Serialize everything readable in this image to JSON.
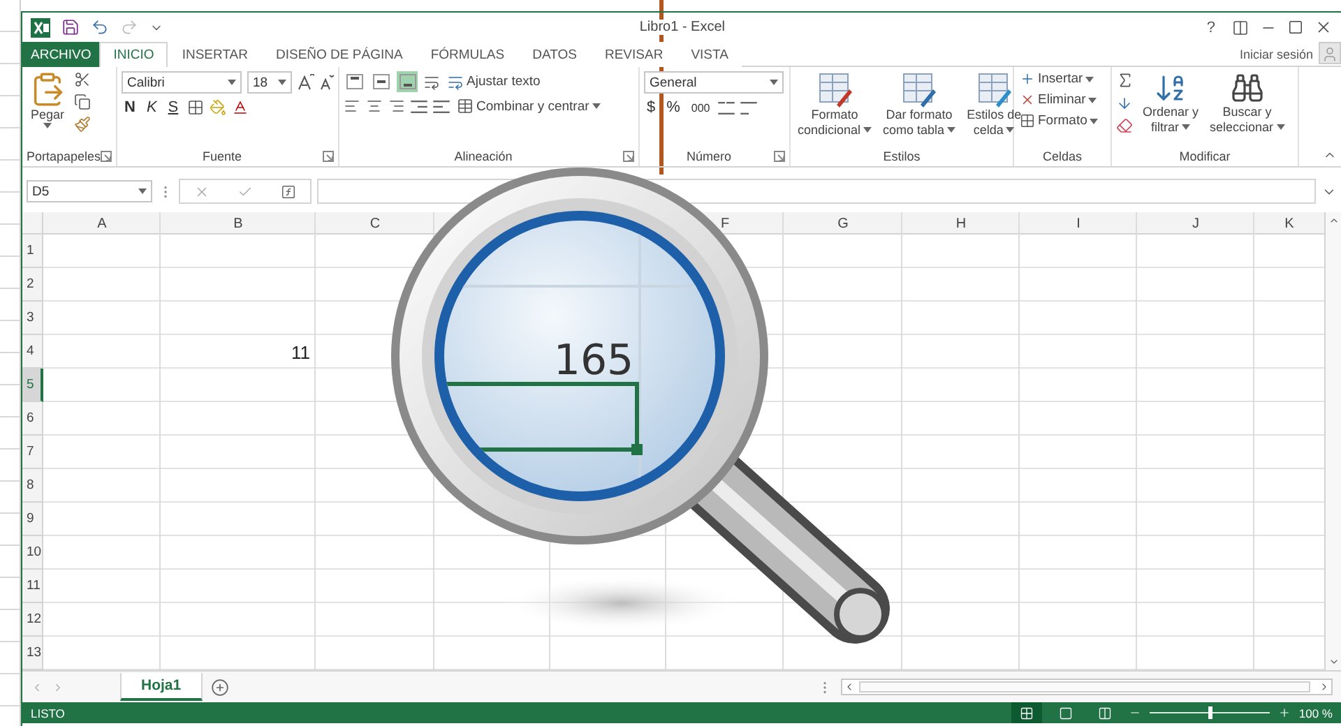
{
  "title_bar": {
    "title": "Libro1 - Excel",
    "help": "?"
  },
  "tabs": [
    {
      "label": "ARCHIVO",
      "kind": "file",
      "selected": false
    },
    {
      "label": "INICIO",
      "kind": "tab",
      "selected": true
    },
    {
      "label": "INSERTAR",
      "kind": "tab",
      "selected": false
    },
    {
      "label": "DISEÑO DE PÁGINA",
      "kind": "tab",
      "selected": false
    },
    {
      "label": "FÓRMULAS",
      "kind": "tab",
      "selected": false
    },
    {
      "label": "DATOS",
      "kind": "tab",
      "selected": false
    },
    {
      "label": "REVISAR",
      "kind": "tab",
      "selected": false
    },
    {
      "label": "VISTA",
      "kind": "tab",
      "selected": false
    }
  ],
  "account": {
    "sign_in": "Iniciar sesión"
  },
  "ribbon": {
    "groups": [
      {
        "kind": "clipboard",
        "label": "Portapapeles",
        "paste": "Pegar"
      },
      {
        "kind": "font",
        "label": "Fuente",
        "font": "Calibri",
        "size": "18",
        "styles": [
          "N",
          "K",
          "S"
        ]
      },
      {
        "kind": "alignment",
        "label": "Alineación",
        "vertical": [
          {
            "selected": false
          },
          {
            "selected": false
          },
          {
            "selected": true
          }
        ],
        "wrap": "Ajustar texto",
        "merge": "Combinar y centrar"
      },
      {
        "kind": "number",
        "label": "Número",
        "format": "General",
        "symbols": [
          "$",
          "%",
          "000"
        ]
      },
      {
        "kind": "styles",
        "label": "Estilos",
        "buttons": [
          {
            "lines": [
              "Formato",
              "condicional"
            ]
          },
          {
            "lines": [
              "Dar formato",
              "como tabla"
            ]
          },
          {
            "lines": [
              "Estilos de",
              "celda"
            ]
          }
        ]
      },
      {
        "kind": "cells",
        "label": "Celdas",
        "buttons": [
          "Insertar",
          "Eliminar",
          "Formato"
        ]
      },
      {
        "kind": "editing",
        "label": "Modificar",
        "buttons": [
          {
            "lines": [
              "Ordenar y",
              "filtrar"
            ]
          },
          {
            "lines": [
              "Buscar y",
              "seleccionar"
            ]
          }
        ]
      }
    ]
  },
  "formula_bar": {
    "name_box": "D5"
  },
  "sheet": {
    "columns": [
      {
        "label": "A"
      },
      {
        "label": "B"
      },
      {
        "label": "C"
      },
      {},
      {},
      {
        "label": "F"
      },
      {
        "label": "G"
      },
      {
        "label": "H"
      },
      {
        "label": "I"
      },
      {
        "label": "J"
      },
      {
        "label": "K"
      }
    ],
    "rows": [
      {
        "label": "1",
        "selected": false
      },
      {
        "label": "2",
        "selected": false
      },
      {
        "label": "3",
        "selected": false
      },
      {
        "label": "4",
        "selected": false,
        "cells": [
          null,
          "11"
        ]
      },
      {
        "label": "5",
        "selected": true
      },
      {
        "label": "6",
        "selected": false
      },
      {
        "label": "7",
        "selected": false
      },
      {
        "label": "8",
        "selected": false
      },
      {
        "label": "9",
        "selected": false
      },
      {
        "label": "10",
        "selected": false
      },
      {
        "label": "11",
        "selected": false
      },
      {
        "label": "12",
        "selected": false
      },
      {
        "label": "13",
        "selected": false
      }
    ]
  },
  "magnifier": {
    "value": "165"
  },
  "sheet_tabs": [
    {
      "label": "Hoja1",
      "selected": true
    }
  ],
  "status_bar": {
    "status": "LISTO",
    "views": [
      {
        "selected": true
      },
      {
        "selected": false
      },
      {
        "selected": false
      }
    ],
    "zoom": {
      "level": 0.5,
      "reading": "100 %"
    }
  }
}
